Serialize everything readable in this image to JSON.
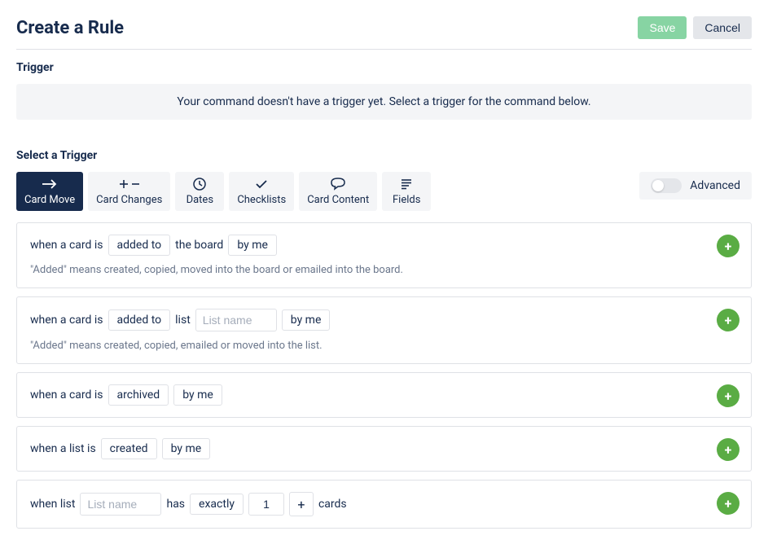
{
  "header": {
    "title": "Create a Rule",
    "save_label": "Save",
    "cancel_label": "Cancel"
  },
  "trigger_section": {
    "label": "Trigger",
    "message": "Your command doesn't have a trigger yet. Select a trigger for the command below."
  },
  "select_trigger": {
    "label": "Select a Trigger",
    "advanced_label": "Advanced"
  },
  "tabs": {
    "card_move": "Card Move",
    "card_changes": "Card Changes",
    "dates": "Dates",
    "checklists": "Checklists",
    "card_content": "Card Content",
    "fields": "Fields"
  },
  "option1": {
    "text_prefix": "when a card is",
    "chip1": "added to",
    "text_mid": "the board",
    "chip2": "by me",
    "hint": "\"Added\" means created, copied, moved into the board or emailed into the board."
  },
  "option2": {
    "text_prefix": "when a card is",
    "chip1": "added to",
    "text_mid": "list",
    "input_placeholder": "List name",
    "chip2": "by me",
    "hint": "\"Added\" means created, copied, emailed or moved into the list."
  },
  "option3": {
    "text_prefix": "when a card is",
    "chip1": "archived",
    "chip2": "by me"
  },
  "option4": {
    "text_prefix": "when a list is",
    "chip1": "created",
    "chip2": "by me"
  },
  "option5": {
    "text_prefix": "when list",
    "input_placeholder": "List name",
    "text_mid": "has",
    "chip1": "exactly",
    "count_value": "1",
    "text_suffix": "cards"
  }
}
